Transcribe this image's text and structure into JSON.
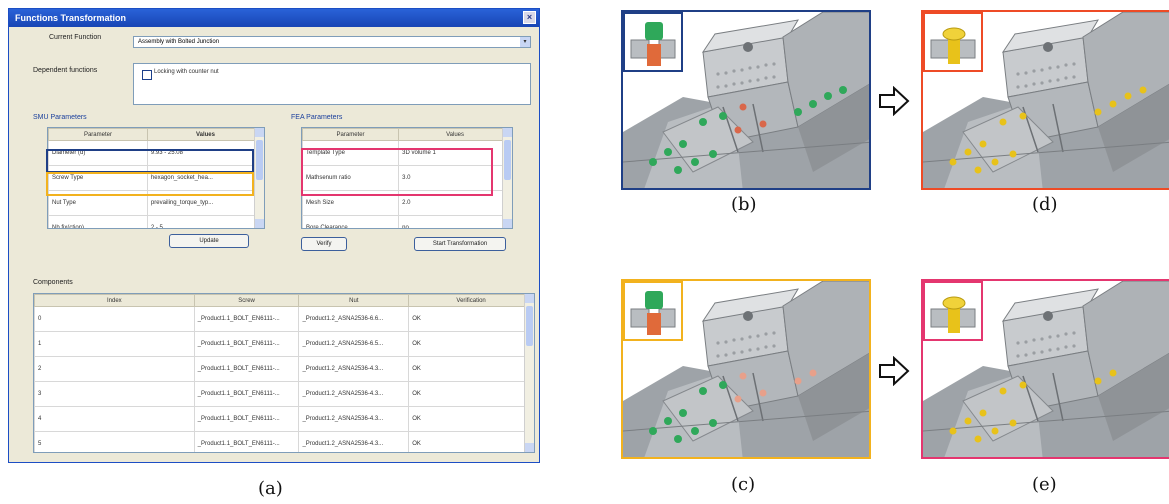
{
  "dialog": {
    "title": "Functions Transformation",
    "close_glyph": "×",
    "current_function_label": "Current Function",
    "current_function_value": "Assembly with Bolted Junction",
    "dependent_functions_label": "Dependent functions",
    "dependent_option": "Locking with counter nut",
    "smu_group": "SMU Parameters",
    "smu_headers": [
      "Parameter",
      "Values"
    ],
    "smu_rows": [
      [
        "Diameter (d)",
        "9.93 - 25.08"
      ],
      [
        "Screw Type",
        "hexagon_socket_hea..."
      ],
      [
        "Nut Type",
        "prevailing_torque_typ..."
      ],
      [
        "Nb fix(ction)",
        "2 - 5"
      ]
    ],
    "update_label": "Update",
    "fea_group": "FEA Parameters",
    "fea_headers": [
      "Parameter",
      "Values"
    ],
    "fea_rows": [
      [
        "Template Type",
        "3D volume 1"
      ],
      [
        "Mathsenum ratio",
        "3.0"
      ],
      [
        "Mesh Size",
        "2.0"
      ],
      [
        "Bore Clearance",
        "no"
      ]
    ],
    "verify_label": "Verify",
    "start_label": "Start Transformation",
    "components_group": "Components",
    "comp_headers": [
      "Index",
      "Screw",
      "Nut",
      "Verification"
    ],
    "comp_rows": [
      [
        "0",
        "_Product1.1_BOLT_EN6111-...",
        "_Product1.2_ASNA2536-6.6...",
        "OK"
      ],
      [
        "1",
        "_Product1.1_BOLT_EN6111-...",
        "_Product1.2_ASNA2536-6.5...",
        "OK"
      ],
      [
        "2",
        "_Product1.1_BOLT_EN6111-...",
        "_Product1.2_ASNA2536-4.3...",
        "OK"
      ],
      [
        "3",
        "_Product1.1_BOLT_EN6111-...",
        "_Product1.2_ASNA2536-4.3...",
        "OK"
      ],
      [
        "4",
        "_Product1.1_BOLT_EN6111-...",
        "_Product1.2_ASNA2536-4.3...",
        "OK"
      ],
      [
        "5",
        "_Product1.1_BOLT_EN6111-...",
        "_Product1.2_ASNA2536-4.3...",
        "OK"
      ]
    ]
  },
  "captions": {
    "a": "(a)",
    "b": "(b)",
    "c": "(c)",
    "d": "(d)",
    "e": "(e)"
  },
  "colors": {
    "blue": "#1f3f86",
    "yellow": "#f2b21e",
    "pink": "#e4366f",
    "red": "#ee4b26",
    "green_bolt": "#2fa85a",
    "gold_bolt": "#e8c21a"
  },
  "icons": [
    "close-icon",
    "chevron-down-icon",
    "checkbox-icon",
    "right-arrow-icon",
    "bolt-inset-icon"
  ]
}
